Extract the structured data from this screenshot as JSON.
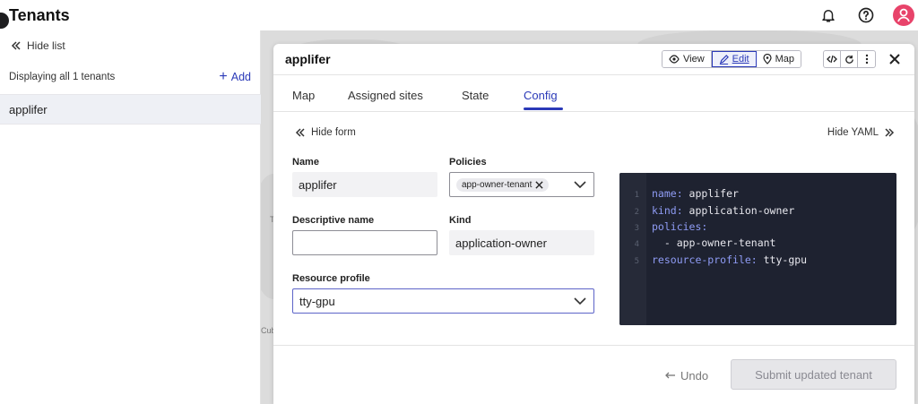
{
  "app": {
    "title": "Tenants"
  },
  "header_icons": [
    "bell-icon",
    "help-icon",
    "user-icon"
  ],
  "colors": {
    "accent": "#2b3ab8",
    "avatar": "#e8436a",
    "yaml_bg": "#1e2230",
    "yaml_key": "#8f9cf5"
  },
  "sidebar": {
    "hide_list_label": "Hide list",
    "count_label": "Displaying all 1 tenants",
    "add_label": "Add",
    "items": [
      {
        "label": "applifer"
      }
    ]
  },
  "map": {
    "labels": [
      "Cub",
      "T"
    ]
  },
  "panel": {
    "title": "applifer",
    "view_buttons": {
      "view": "View",
      "edit": "Edit",
      "map": "Map"
    },
    "tabs": [
      {
        "label": "Map"
      },
      {
        "label": "Assigned sites"
      },
      {
        "label": "State"
      },
      {
        "label": "Config"
      }
    ],
    "active_tab": "Config"
  },
  "form": {
    "hide_form_label": "Hide form",
    "hide_yaml_label": "Hide YAML",
    "name": {
      "label": "Name",
      "value": "applifer"
    },
    "policies": {
      "label": "Policies",
      "chips": [
        "app-owner-tenant"
      ]
    },
    "descriptive_name": {
      "label": "Descriptive name",
      "value": ""
    },
    "kind": {
      "label": "Kind",
      "value": "application-owner"
    },
    "resource_profile": {
      "label": "Resource profile",
      "value": "tty-gpu"
    }
  },
  "yaml": {
    "lines": [
      {
        "num": "1",
        "key": "name:",
        "value": " applifer"
      },
      {
        "num": "2",
        "key": "kind:",
        "value": " application-owner"
      },
      {
        "num": "3",
        "key": "policies:",
        "value": ""
      },
      {
        "num": "4",
        "key": "",
        "value": "  - app-owner-tenant"
      },
      {
        "num": "5",
        "key": "resource-profile:",
        "value": " tty-gpu"
      }
    ]
  },
  "footer": {
    "undo_label": "Undo",
    "submit_label": "Submit updated tenant"
  }
}
